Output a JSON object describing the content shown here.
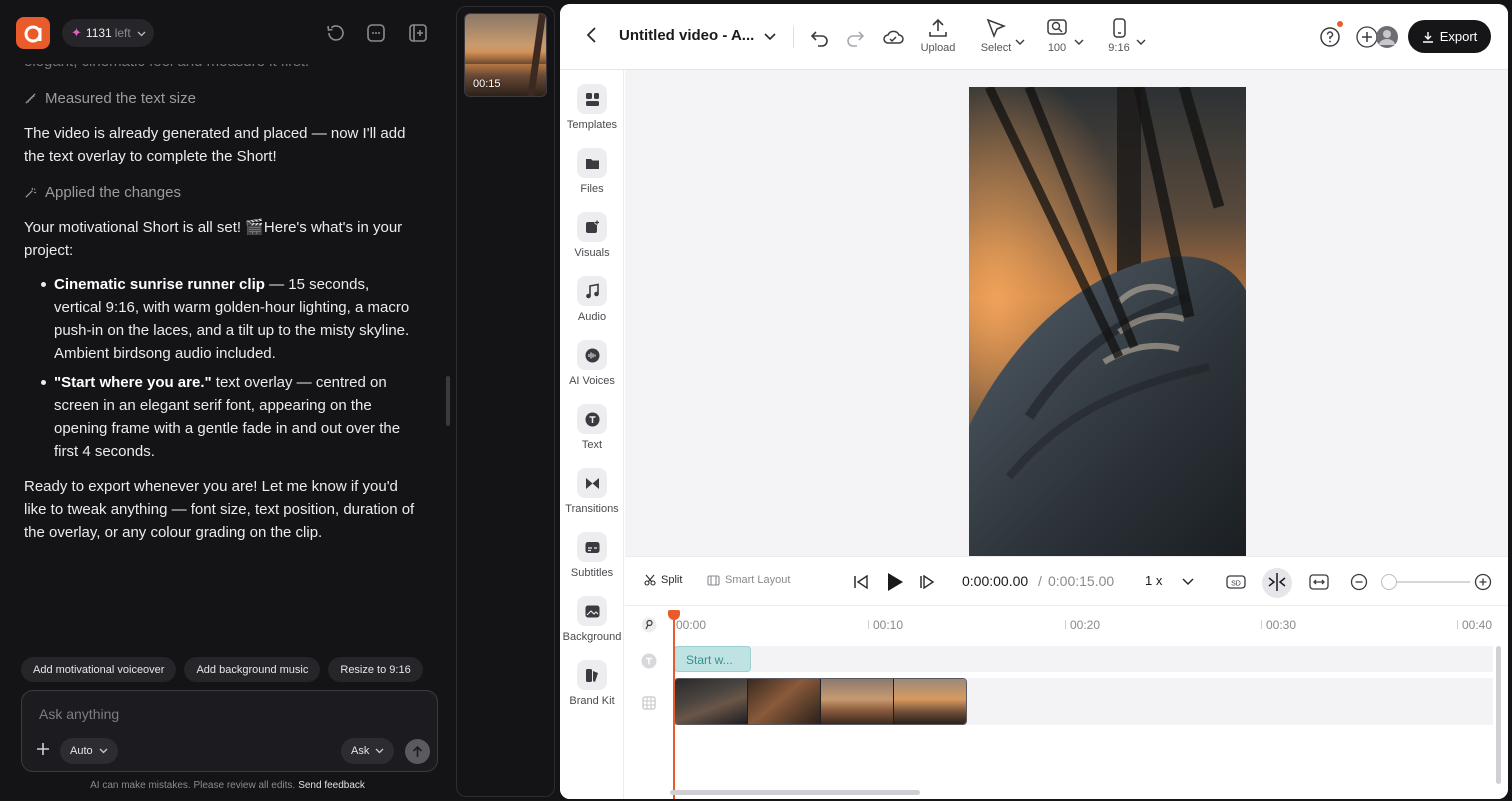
{
  "app": {
    "credits_count": "1131",
    "credits_suffix": "left"
  },
  "chat": {
    "faded_text": "elegant, cinematic feel and measure it first.",
    "step1": "Measured the text size",
    "para1": "The video is already generated and placed — now I'll add the text overlay to complete the Short!",
    "step2": "Applied the changes",
    "para2": "Your motivational Short is all set! 🎬Here's what's in your project:",
    "bullets": [
      {
        "bold": "Cinematic sunrise runner clip",
        "text": " — 15 seconds, vertical 9:16, with warm golden-hour lighting, a macro push-in on the laces, and a tilt up to the misty skyline. Ambient birdsong audio included."
      },
      {
        "bold": "\"Start where you are.\"",
        "text": " text overlay — centred on screen in an elegant serif font, appearing on the opening frame with a gentle fade in and out over the first 4 seconds."
      }
    ],
    "para3": "Ready to export whenever you are! Let me know if you'd like to tweak anything — font size, text position, duration of the overlay, or any colour grading on the clip.",
    "chips": [
      "Add motivational voiceover",
      "Add background music",
      "Resize to 9:16"
    ],
    "input_placeholder": "Ask anything",
    "mode_auto": "Auto",
    "mode_ask": "Ask",
    "disclaimer": "AI can make mistakes. Please review all edits.",
    "feedback_link": "Send feedback"
  },
  "scenes": {
    "duration": "00:15"
  },
  "toolbar": {
    "title": "Untitled video - A...",
    "upload": "Upload",
    "select": "Select",
    "zoom": "100",
    "ratio": "9:16",
    "export": "Export"
  },
  "leftnav": [
    "Templates",
    "Files",
    "Visuals",
    "Audio",
    "AI Voices",
    "Text",
    "Transitions",
    "Subtitles",
    "Background",
    "Brand Kit"
  ],
  "controls": {
    "split": "Split",
    "smart_layout": "Smart Layout",
    "time_current": "0:00:00.00",
    "time_sep": "/",
    "time_total": "0:00:15.00",
    "speed": "1 x"
  },
  "timeline": {
    "ticks": [
      "00:00",
      "00:10",
      "00:20",
      "00:30",
      "00:40"
    ],
    "text_clip": "Start w..."
  },
  "colors": {
    "accent": "#ea5b2c",
    "text_clip": "#bfe3e3"
  }
}
